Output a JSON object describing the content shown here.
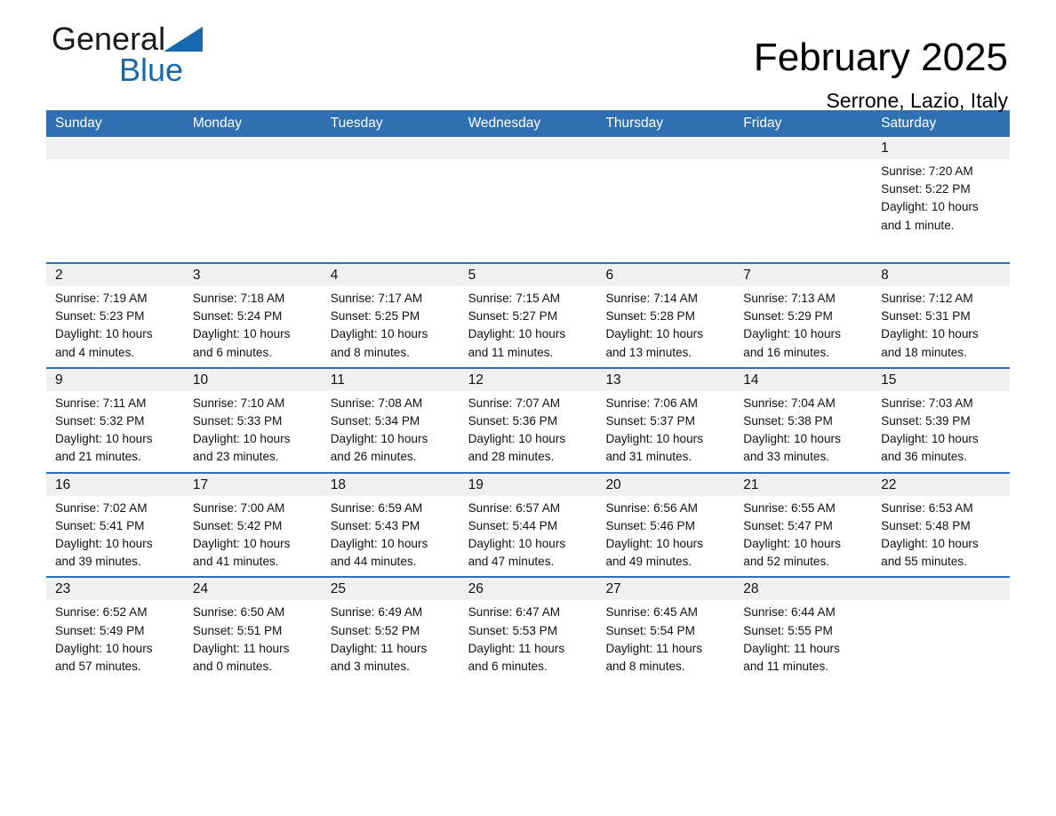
{
  "brand": {
    "name_part1": "General",
    "name_part2": "Blue",
    "triangle_color": "#1769ae"
  },
  "header": {
    "month_title": "February 2025",
    "location": "Serrone, Lazio, Italy"
  },
  "colors": {
    "header_blue": "#2e70b2",
    "row_band_gray": "#f0f0f0",
    "text": "#111111"
  },
  "weekdays": [
    "Sunday",
    "Monday",
    "Tuesday",
    "Wednesday",
    "Thursday",
    "Friday",
    "Saturday"
  ],
  "weeks": [
    {
      "days": [
        {
          "num": "",
          "sunrise": "",
          "sunset": "",
          "daylight1": "",
          "daylight2": ""
        },
        {
          "num": "",
          "sunrise": "",
          "sunset": "",
          "daylight1": "",
          "daylight2": ""
        },
        {
          "num": "",
          "sunrise": "",
          "sunset": "",
          "daylight1": "",
          "daylight2": ""
        },
        {
          "num": "",
          "sunrise": "",
          "sunset": "",
          "daylight1": "",
          "daylight2": ""
        },
        {
          "num": "",
          "sunrise": "",
          "sunset": "",
          "daylight1": "",
          "daylight2": ""
        },
        {
          "num": "",
          "sunrise": "",
          "sunset": "",
          "daylight1": "",
          "daylight2": ""
        },
        {
          "num": "1",
          "sunrise": "Sunrise: 7:20 AM",
          "sunset": "Sunset: 5:22 PM",
          "daylight1": "Daylight: 10 hours",
          "daylight2": "and 1 minute."
        }
      ]
    },
    {
      "days": [
        {
          "num": "2",
          "sunrise": "Sunrise: 7:19 AM",
          "sunset": "Sunset: 5:23 PM",
          "daylight1": "Daylight: 10 hours",
          "daylight2": "and 4 minutes."
        },
        {
          "num": "3",
          "sunrise": "Sunrise: 7:18 AM",
          "sunset": "Sunset: 5:24 PM",
          "daylight1": "Daylight: 10 hours",
          "daylight2": "and 6 minutes."
        },
        {
          "num": "4",
          "sunrise": "Sunrise: 7:17 AM",
          "sunset": "Sunset: 5:25 PM",
          "daylight1": "Daylight: 10 hours",
          "daylight2": "and 8 minutes."
        },
        {
          "num": "5",
          "sunrise": "Sunrise: 7:15 AM",
          "sunset": "Sunset: 5:27 PM",
          "daylight1": "Daylight: 10 hours",
          "daylight2": "and 11 minutes."
        },
        {
          "num": "6",
          "sunrise": "Sunrise: 7:14 AM",
          "sunset": "Sunset: 5:28 PM",
          "daylight1": "Daylight: 10 hours",
          "daylight2": "and 13 minutes."
        },
        {
          "num": "7",
          "sunrise": "Sunrise: 7:13 AM",
          "sunset": "Sunset: 5:29 PM",
          "daylight1": "Daylight: 10 hours",
          "daylight2": "and 16 minutes."
        },
        {
          "num": "8",
          "sunrise": "Sunrise: 7:12 AM",
          "sunset": "Sunset: 5:31 PM",
          "daylight1": "Daylight: 10 hours",
          "daylight2": "and 18 minutes."
        }
      ]
    },
    {
      "days": [
        {
          "num": "9",
          "sunrise": "Sunrise: 7:11 AM",
          "sunset": "Sunset: 5:32 PM",
          "daylight1": "Daylight: 10 hours",
          "daylight2": "and 21 minutes."
        },
        {
          "num": "10",
          "sunrise": "Sunrise: 7:10 AM",
          "sunset": "Sunset: 5:33 PM",
          "daylight1": "Daylight: 10 hours",
          "daylight2": "and 23 minutes."
        },
        {
          "num": "11",
          "sunrise": "Sunrise: 7:08 AM",
          "sunset": "Sunset: 5:34 PM",
          "daylight1": "Daylight: 10 hours",
          "daylight2": "and 26 minutes."
        },
        {
          "num": "12",
          "sunrise": "Sunrise: 7:07 AM",
          "sunset": "Sunset: 5:36 PM",
          "daylight1": "Daylight: 10 hours",
          "daylight2": "and 28 minutes."
        },
        {
          "num": "13",
          "sunrise": "Sunrise: 7:06 AM",
          "sunset": "Sunset: 5:37 PM",
          "daylight1": "Daylight: 10 hours",
          "daylight2": "and 31 minutes."
        },
        {
          "num": "14",
          "sunrise": "Sunrise: 7:04 AM",
          "sunset": "Sunset: 5:38 PM",
          "daylight1": "Daylight: 10 hours",
          "daylight2": "and 33 minutes."
        },
        {
          "num": "15",
          "sunrise": "Sunrise: 7:03 AM",
          "sunset": "Sunset: 5:39 PM",
          "daylight1": "Daylight: 10 hours",
          "daylight2": "and 36 minutes."
        }
      ]
    },
    {
      "days": [
        {
          "num": "16",
          "sunrise": "Sunrise: 7:02 AM",
          "sunset": "Sunset: 5:41 PM",
          "daylight1": "Daylight: 10 hours",
          "daylight2": "and 39 minutes."
        },
        {
          "num": "17",
          "sunrise": "Sunrise: 7:00 AM",
          "sunset": "Sunset: 5:42 PM",
          "daylight1": "Daylight: 10 hours",
          "daylight2": "and 41 minutes."
        },
        {
          "num": "18",
          "sunrise": "Sunrise: 6:59 AM",
          "sunset": "Sunset: 5:43 PM",
          "daylight1": "Daylight: 10 hours",
          "daylight2": "and 44 minutes."
        },
        {
          "num": "19",
          "sunrise": "Sunrise: 6:57 AM",
          "sunset": "Sunset: 5:44 PM",
          "daylight1": "Daylight: 10 hours",
          "daylight2": "and 47 minutes."
        },
        {
          "num": "20",
          "sunrise": "Sunrise: 6:56 AM",
          "sunset": "Sunset: 5:46 PM",
          "daylight1": "Daylight: 10 hours",
          "daylight2": "and 49 minutes."
        },
        {
          "num": "21",
          "sunrise": "Sunrise: 6:55 AM",
          "sunset": "Sunset: 5:47 PM",
          "daylight1": "Daylight: 10 hours",
          "daylight2": "and 52 minutes."
        },
        {
          "num": "22",
          "sunrise": "Sunrise: 6:53 AM",
          "sunset": "Sunset: 5:48 PM",
          "daylight1": "Daylight: 10 hours",
          "daylight2": "and 55 minutes."
        }
      ]
    },
    {
      "days": [
        {
          "num": "23",
          "sunrise": "Sunrise: 6:52 AM",
          "sunset": "Sunset: 5:49 PM",
          "daylight1": "Daylight: 10 hours",
          "daylight2": "and 57 minutes."
        },
        {
          "num": "24",
          "sunrise": "Sunrise: 6:50 AM",
          "sunset": "Sunset: 5:51 PM",
          "daylight1": "Daylight: 11 hours",
          "daylight2": "and 0 minutes."
        },
        {
          "num": "25",
          "sunrise": "Sunrise: 6:49 AM",
          "sunset": "Sunset: 5:52 PM",
          "daylight1": "Daylight: 11 hours",
          "daylight2": "and 3 minutes."
        },
        {
          "num": "26",
          "sunrise": "Sunrise: 6:47 AM",
          "sunset": "Sunset: 5:53 PM",
          "daylight1": "Daylight: 11 hours",
          "daylight2": "and 6 minutes."
        },
        {
          "num": "27",
          "sunrise": "Sunrise: 6:45 AM",
          "sunset": "Sunset: 5:54 PM",
          "daylight1": "Daylight: 11 hours",
          "daylight2": "and 8 minutes."
        },
        {
          "num": "28",
          "sunrise": "Sunrise: 6:44 AM",
          "sunset": "Sunset: 5:55 PM",
          "daylight1": "Daylight: 11 hours",
          "daylight2": "and 11 minutes."
        },
        {
          "num": "",
          "sunrise": "",
          "sunset": "",
          "daylight1": "",
          "daylight2": ""
        }
      ]
    }
  ]
}
